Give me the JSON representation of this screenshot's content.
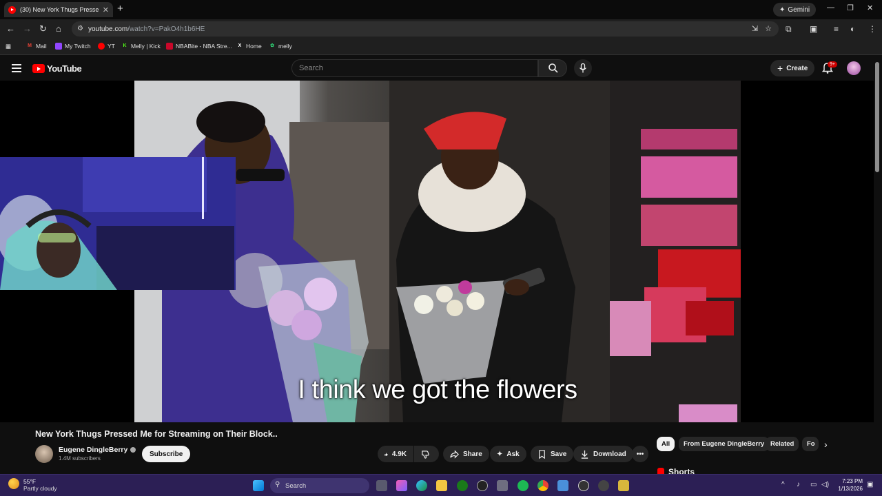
{
  "browser": {
    "tab_title": "(30) New York Thugs Presse",
    "gemini_label": "Gemini",
    "url_host": "youtube.com",
    "url_path": "/watch?v=PakO4h1b6HE",
    "bookmarks": [
      {
        "label": "Mail",
        "icon": "gmail-icon",
        "color": "#ea4335"
      },
      {
        "label": "My Twitch",
        "icon": "twitch-icon",
        "color": "#9146ff"
      },
      {
        "label": "YT",
        "icon": "youtube-icon",
        "color": "#ff0000"
      },
      {
        "label": "Melly | Kick",
        "icon": "kick-icon",
        "color": "#53fc18"
      },
      {
        "label": "NBABite - NBA Stre...",
        "icon": "nba-icon",
        "color": "#c9082a"
      },
      {
        "label": "Home",
        "icon": "x-icon",
        "color": "#ffffff"
      },
      {
        "label": "melly",
        "icon": "leaf-icon",
        "color": "#2ecc71"
      }
    ]
  },
  "youtube": {
    "logo_text": "YouTube",
    "search_placeholder": "Search",
    "create_label": "Create",
    "notif_badge": "9+",
    "video": {
      "caption": "I think we got the flowers",
      "title": "New York Thugs Pressed Me for Streaming on Their Block..",
      "channel": "Eugene DingleBerry",
      "subscribers": "1.4M subscribers",
      "subscribe_label": "Subscribe",
      "likes": "4.9K",
      "share_label": "Share",
      "ask_label": "Ask",
      "save_label": "Save",
      "download_label": "Download"
    },
    "chips": [
      "All",
      "From Eugene DingleBerry",
      "Related",
      "Fo"
    ],
    "shorts_label": "Shorts"
  },
  "taskbar": {
    "temperature": "55°F",
    "condition": "Partly cloudy",
    "search_label": "Search",
    "time": "7:23 PM",
    "date": "1/13/2026"
  },
  "colors": {
    "yt_red": "#ff0000",
    "accent_bg": "#0f0f0f",
    "taskbar": "#2c1f55"
  }
}
